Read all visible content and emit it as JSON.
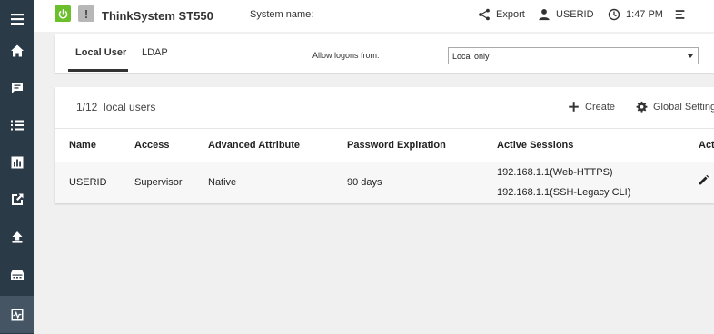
{
  "sidebar": {
    "items": [
      {
        "name": "menu-icon"
      },
      {
        "name": "home-icon"
      },
      {
        "name": "events-icon"
      },
      {
        "name": "inventory-icon"
      },
      {
        "name": "utilization-icon"
      },
      {
        "name": "remote-console-icon"
      },
      {
        "name": "firmware-update-icon"
      },
      {
        "name": "server-config-icon"
      },
      {
        "name": "bmc-config-icon",
        "active": true
      }
    ]
  },
  "header": {
    "title": "ThinkSystem ST550",
    "warning_glyph": "!",
    "system_name_label": "System name:",
    "export_label": "Export",
    "user_label": "USERID",
    "time_label": "1:47 PM"
  },
  "tabs": [
    {
      "label": "Local User",
      "active": true
    },
    {
      "label": "LDAP",
      "active": false
    }
  ],
  "logon": {
    "label": "Allow logons from:",
    "value": "Local only"
  },
  "users": {
    "count": "1/12",
    "title": "local users",
    "create_label": "Create",
    "global_settings_label": "Global Settings",
    "columns": [
      "Name",
      "Access",
      "Advanced Attribute",
      "Password Expiration",
      "Active Sessions",
      "Action"
    ],
    "rows": [
      {
        "name": "USERID",
        "access": "Supervisor",
        "advanced_attribute": "Native",
        "password_expiration": "90 days",
        "sessions": [
          "192.168.1.1(Web-HTTPS)",
          "192.168.1.1(SSH-Legacy CLI)"
        ]
      }
    ]
  },
  "colors": {
    "sidebar_bg": "#2b3a47",
    "sidebar_active": "#455563",
    "power_green": "#6abf2b"
  }
}
